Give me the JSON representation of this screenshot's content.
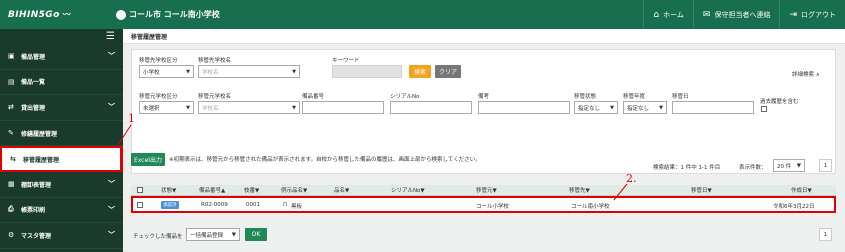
{
  "header": {
    "brand": "BIHIN5Go",
    "school_name": "コール市 コール南小学校",
    "nav": [
      {
        "label": "ホーム",
        "icon": "home-icon"
      },
      {
        "label": "保守担当者へ連絡",
        "icon": "mail-icon"
      },
      {
        "label": "ログアウト",
        "icon": "logout-icon"
      }
    ]
  },
  "sidebar": {
    "items": [
      {
        "label": "備品管理",
        "icon": "box-icon",
        "has_chevron": true
      },
      {
        "label": "備品一覧",
        "icon": "list-icon",
        "has_chevron": false
      },
      {
        "label": "貸出管理",
        "icon": "exchange-icon",
        "has_chevron": true
      },
      {
        "label": "修繕履歴管理",
        "icon": "wrench-icon",
        "has_chevron": false
      },
      {
        "label": "移管履歴管理",
        "icon": "transfer-icon",
        "has_chevron": false,
        "active": true
      },
      {
        "label": "棚卸表管理",
        "icon": "clipboard-icon",
        "has_chevron": true
      },
      {
        "label": "帳票印刷",
        "icon": "print-icon",
        "has_chevron": true
      },
      {
        "label": "マスタ管理",
        "icon": "gear-icon",
        "has_chevron": true
      }
    ]
  },
  "page": {
    "title": "移管履歴管理"
  },
  "search": {
    "row1": {
      "dest_type_label": "移管先学校区分",
      "dest_type_value": "小学校",
      "dest_school_label": "移管先学校名",
      "dest_school_placeholder": "学校名",
      "keyword_label": "キーワード",
      "search_button": "検索",
      "clear_button": "クリア",
      "advanced_toggle": "詳細検索 ∧"
    },
    "row2": {
      "src_type_label": "移管元学校区分",
      "src_type_value": "未選択",
      "src_school_label": "移管元学校名",
      "src_school_placeholder": "学校名",
      "item_no_label": "備品番号",
      "serial_label": "シリアルNo",
      "note_label": "備考",
      "status_label": "移管状態",
      "status_value": "指定なし",
      "year_label": "移管年度",
      "year_value": "指定なし",
      "date_label": "移管日",
      "include_past_label": "過去履歴を含む"
    }
  },
  "actions": {
    "excel_button": "Excel出力",
    "notice": "※初期表示は、移管元から移管された備品が表示されます。自校から移管した備品の履歴は、画面上部から検索してください。",
    "result_count": "検索結果：1 件中 1-1 件目",
    "per_page_label": "表示件数：",
    "per_page_value": "20 件",
    "page": "1"
  },
  "table": {
    "columns": [
      "状態▼",
      "備品番号▲",
      "枝番▼",
      "例示品名▼",
      "品名▼",
      "シリアルNo▼",
      "移管元▼",
      "移管先▼",
      "移管日▼",
      "作成日▼"
    ],
    "rows": [
      {
        "status": "承認済",
        "item_no": "R02-0009",
        "branch": "0001",
        "example_name": "黒板",
        "name": "",
        "serial": "",
        "src": "コール小学校",
        "dest": "コール南小学校",
        "transfer_date": "",
        "created": "令和6年3月22日"
      }
    ]
  },
  "footer": {
    "checked_label": "チェックした備品を",
    "bulk_select": "一括備品登録",
    "ok_button": "OK",
    "page": "1"
  },
  "annotations": {
    "one": "1",
    "two": "2."
  },
  "colors": {
    "header_green": "#176f4f",
    "sidebar_dark": "#1a3a2c",
    "search_orange": "#f7a21b",
    "highlight_red": "#e00000",
    "excel_green": "#1f8a57"
  }
}
